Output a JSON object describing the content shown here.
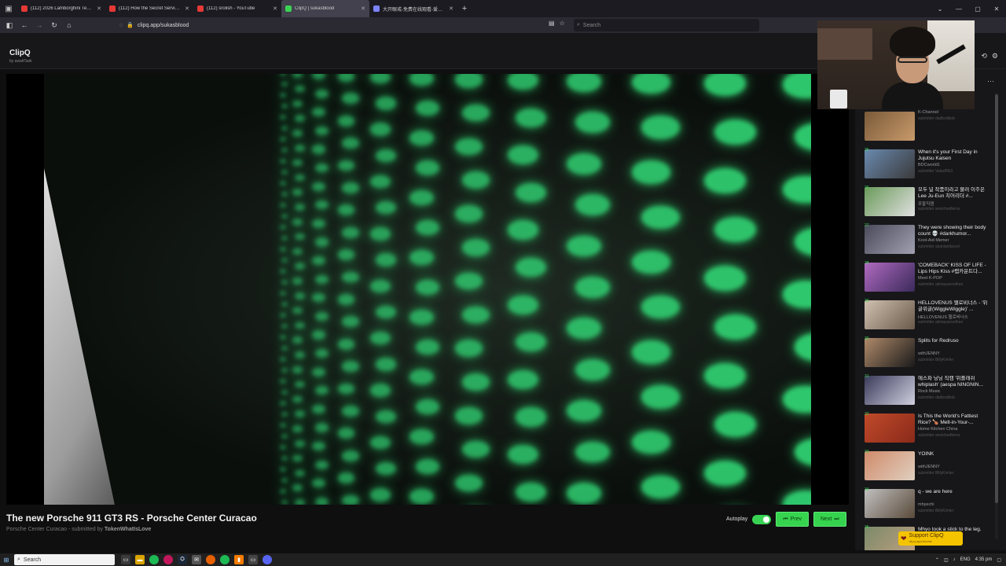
{
  "tabs": [
    {
      "label": "(112) 2026 Lamborghini Temer...",
      "color": "#e53935"
    },
    {
      "label": "(112) How the Secret Service A...",
      "color": "#e53935"
    },
    {
      "label": "(112) srolish - YouTube",
      "color": "#e53935"
    },
    {
      "label": "ClipQ | sukasblood",
      "color": "#39d353"
    },
    {
      "label": "大开眼戒-免费在线观看-爱壹帆",
      "color": "#7c83ff"
    }
  ],
  "url": "clipq.app/sukasblood",
  "search_placeholder": "Search",
  "app": {
    "brand": "ClipQ",
    "byline": "by awaitTask"
  },
  "video": {
    "title": "The new Porsche 911 GT3 RS - Porsche Center Curacao",
    "channel": "Porsche Center Curacao",
    "submitted_prefix": "- submitted by",
    "submitter": "TokenWhatIsLove"
  },
  "controls": {
    "autoplay": "Autoplay",
    "prev": "Prev",
    "next": "Next"
  },
  "queue": [
    {
      "num": "",
      "title": "",
      "channel": "K-Channel",
      "sub": "submitter dadbodbob",
      "colors": [
        "#7a5a3a",
        "#c89a6a"
      ]
    },
    {
      "num": "25",
      "title": "When it's your First Day in Jujutsu Kaisen",
      "channel": "BDCworld1",
      "sub": "submitter ValueBN3",
      "colors": [
        "#6a8ab0",
        "#3a3a3a"
      ]
    },
    {
      "num": "26",
      "title": "모두 널 작품이라고 불러 이주은Lee Ju-Eun 치어리더 #...",
      "channel": "포팔직캠",
      "sub": "submitter wretchedferns",
      "colors": [
        "#6a9a5a",
        "#e0e0e0"
      ]
    },
    {
      "num": "27",
      "title": "They were showing their body count 💀 #darkhumor...",
      "channel": "Kool-Aid Memer",
      "sub": "submitter spanlambcool",
      "colors": [
        "#4a4a5a",
        "#a0a0b0"
      ]
    },
    {
      "num": "28",
      "title": "'COMEBACK' KISS OF LIFE - Lips Hips Kiss #랩카운트다...",
      "channel": "Meet K-POP",
      "sub": "submitter akmayaesothee",
      "colors": [
        "#b06ac0",
        "#3a2a5a"
      ]
    },
    {
      "num": "29",
      "title": "HELLOVENUS 헬로비너스 - '위글위글(WiggleWiggle)' ...",
      "channel": "HELLOVENUS 헬로비너스",
      "sub": "submitter akmayaesothee",
      "colors": [
        "#d0c0b0",
        "#6a5a4a"
      ]
    },
    {
      "num": "30",
      "title": "Splits for Redruso",
      "channel": "withJENNY",
      "sub": "submitter BillyKimler",
      "colors": [
        "#b08a6a",
        "#1a1a1a"
      ]
    },
    {
      "num": "31",
      "title": "에스파 닝닝 직캠 '위플래쉬 whiplash' (aespa NINGNIN...",
      "channel": "Rock Music",
      "sub": "submitter dadbodbob",
      "colors": [
        "#3a3a5a",
        "#d0d0e0"
      ]
    },
    {
      "num": "32",
      "title": "Is This the World's Fattiest Rice? 🍗 Melt-in-Your-...",
      "channel": "Home Kitchen China",
      "sub": "submitter wretchedferns",
      "colors": [
        "#c04a2a",
        "#8a2a1a"
      ]
    },
    {
      "num": "33",
      "title": "YOINK",
      "channel": "withJENNY",
      "sub": "submitter BillyKimler",
      "colors": [
        "#d08a6a",
        "#e0d0c0"
      ]
    },
    {
      "num": "34",
      "title": "q - we are here",
      "channel": "mhyechi",
      "sub": "submitter BillyKimler",
      "colors": [
        "#c0c0c0",
        "#5a4a3a"
      ]
    },
    {
      "num": "35",
      "title": "Mhyo took a stick to the leg. Mhyo is a beast.",
      "channel": "",
      "sub": "",
      "colors": [
        "#7a8a6a",
        "#c0a080"
      ]
    }
  ],
  "support": {
    "label": "Support ClipQ",
    "url": "clipq.app/donate"
  },
  "taskbar": {
    "search": "Search",
    "lang": "ENG",
    "time": "4:35 pm"
  }
}
